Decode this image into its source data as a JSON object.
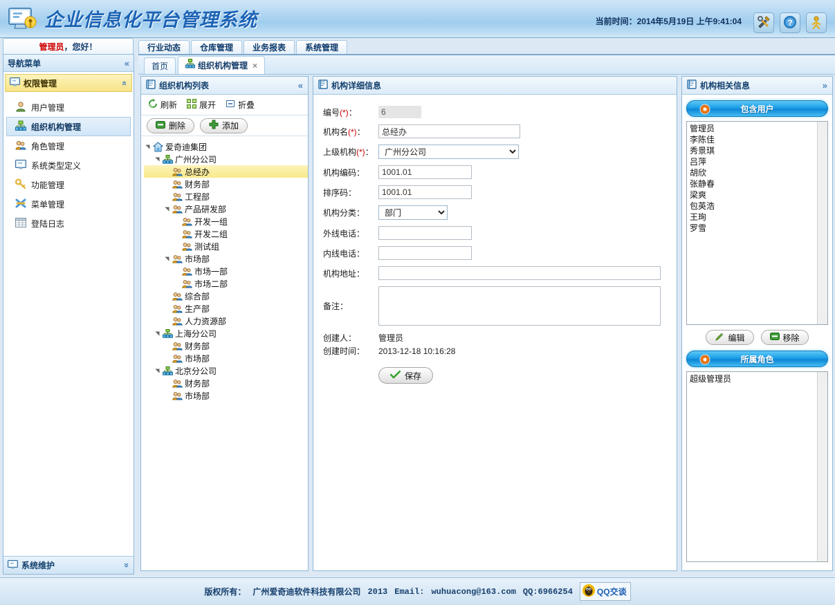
{
  "header": {
    "app_title": "企业信息化平台管理系统",
    "clock_label": "当前时间：",
    "clock_value": "2014年5月19日  上午9:41:04",
    "buttons": [
      {
        "name": "tools-icon",
        "title": "工具"
      },
      {
        "name": "help-icon",
        "title": "帮助"
      },
      {
        "name": "user-icon",
        "title": "用户"
      }
    ],
    "accent_color": "#1c63b5"
  },
  "greeting": {
    "user": "管理员",
    "rest": "，您好！"
  },
  "topmenu": {
    "items": [
      "行业动态",
      "仓库管理",
      "业务报表",
      "系统管理"
    ]
  },
  "tabs": [
    {
      "label": "首页",
      "active": false,
      "closable": false
    },
    {
      "label": "组织机构管理",
      "active": true,
      "closable": true,
      "close": "×"
    }
  ],
  "nav": {
    "title": "导航菜单",
    "collapse_icon": "«",
    "group": {
      "label": "权限管理",
      "icon": "monitor-icon",
      "chevron": "«"
    },
    "items": [
      {
        "label": "用户管理",
        "icon": "user-icon",
        "selected": false
      },
      {
        "label": "组织机构管理",
        "icon": "org-icon",
        "selected": true
      },
      {
        "label": "角色管理",
        "icon": "roles-icon",
        "selected": false
      },
      {
        "label": "系统类型定义",
        "icon": "monitor-icon",
        "selected": false
      },
      {
        "label": "功能管理",
        "icon": "key-icon",
        "selected": false
      },
      {
        "label": "菜单管理",
        "icon": "menu-icon",
        "selected": false
      },
      {
        "label": "登陆日志",
        "icon": "grid-icon",
        "selected": false
      }
    ],
    "bottom_group": {
      "label": "系统维护",
      "icon": "monitor-icon",
      "chevron": "»"
    }
  },
  "tree_panel": {
    "title": "组织机构列表",
    "collapse_icon": "«",
    "toolbar": [
      {
        "label": "刷新",
        "icon": "refresh-icon"
      },
      {
        "label": "展开",
        "icon": "expand-icon"
      },
      {
        "label": "折叠",
        "icon": "collapse-icon"
      }
    ],
    "buttons": [
      {
        "label": "删除",
        "icon": "minus-icon"
      },
      {
        "label": "添加",
        "icon": "plus-icon"
      }
    ],
    "nodes": [
      {
        "label": "爱奇迪集团",
        "depth": 0,
        "icon": "home-icon",
        "arrow": "▴",
        "selected": false
      },
      {
        "label": "广州分公司",
        "depth": 1,
        "icon": "branch-icon",
        "arrow": "▴",
        "selected": false
      },
      {
        "label": "总经办",
        "depth": 2,
        "icon": "dept-icon",
        "arrow": "",
        "selected": true
      },
      {
        "label": "财务部",
        "depth": 2,
        "icon": "dept-icon",
        "arrow": "",
        "selected": false
      },
      {
        "label": "工程部",
        "depth": 2,
        "icon": "dept-icon",
        "arrow": "",
        "selected": false
      },
      {
        "label": "产品研发部",
        "depth": 2,
        "icon": "dept-icon",
        "arrow": "▴",
        "selected": false
      },
      {
        "label": "开发一组",
        "depth": 3,
        "icon": "dept-icon",
        "arrow": "",
        "selected": false
      },
      {
        "label": "开发二组",
        "depth": 3,
        "icon": "dept-icon",
        "arrow": "",
        "selected": false
      },
      {
        "label": "测试组",
        "depth": 3,
        "icon": "dept-icon",
        "arrow": "",
        "selected": false
      },
      {
        "label": "市场部",
        "depth": 2,
        "icon": "dept-icon",
        "arrow": "▴",
        "selected": false
      },
      {
        "label": "市场一部",
        "depth": 3,
        "icon": "dept-icon",
        "arrow": "",
        "selected": false
      },
      {
        "label": "市场二部",
        "depth": 3,
        "icon": "dept-icon",
        "arrow": "",
        "selected": false
      },
      {
        "label": "综合部",
        "depth": 2,
        "icon": "dept-icon",
        "arrow": "",
        "selected": false
      },
      {
        "label": "生产部",
        "depth": 2,
        "icon": "dept-icon",
        "arrow": "",
        "selected": false
      },
      {
        "label": "人力资源部",
        "depth": 2,
        "icon": "dept-icon",
        "arrow": "",
        "selected": false
      },
      {
        "label": "上海分公司",
        "depth": 1,
        "icon": "branch-icon",
        "arrow": "▴",
        "selected": false
      },
      {
        "label": "财务部",
        "depth": 2,
        "icon": "dept-icon",
        "arrow": "",
        "selected": false
      },
      {
        "label": "市场部",
        "depth": 2,
        "icon": "dept-icon",
        "arrow": "",
        "selected": false
      },
      {
        "label": "北京分公司",
        "depth": 1,
        "icon": "branch-icon",
        "arrow": "▴",
        "selected": false
      },
      {
        "label": "财务部",
        "depth": 2,
        "icon": "dept-icon",
        "arrow": "",
        "selected": false
      },
      {
        "label": "市场部",
        "depth": 2,
        "icon": "dept-icon",
        "arrow": "",
        "selected": false
      }
    ]
  },
  "detail_panel": {
    "title": "机构详细信息",
    "fields": {
      "id_label": "编号(*)：",
      "id_value": "6",
      "name_label": "机构名(*)：",
      "name_value": "总经办",
      "parent_label": "上级机构(*)：",
      "parent_value": "广州分公司",
      "code_label": "机构编码：",
      "code_value": "1001.01",
      "sort_label": "排序码：",
      "sort_value": "1001.01",
      "type_label": "机构分类：",
      "type_value": "部门",
      "outer_phone_label": "外线电话：",
      "outer_phone_value": "",
      "inner_phone_label": "内线电话：",
      "inner_phone_value": "",
      "address_label": "机构地址：",
      "address_value": "",
      "remark_label": "备注：",
      "remark_value": "",
      "creator_label": "创建人：",
      "creator_value": "管理员",
      "created_label": "创建时间：",
      "created_value": "2013-12-18  10:16:28"
    },
    "save_button": "保存"
  },
  "info_panel": {
    "title": "机构相关信息",
    "expand_icon": "»",
    "users_section": {
      "title": "包含用户",
      "bullet": "●"
    },
    "users": [
      "管理员",
      "李陈佳",
      "秀景琪",
      "吕萍",
      "胡欣",
      "张静春",
      "梁爽",
      "包英浩",
      "王珣",
      "罗雪"
    ],
    "user_buttons": [
      {
        "label": "编辑",
        "icon": "pencil-icon"
      },
      {
        "label": "移除",
        "icon": "minus-icon"
      }
    ],
    "roles_section": {
      "title": "所属角色",
      "bullet": "●"
    },
    "roles": [
      "超级管理员"
    ]
  },
  "footer": {
    "copyright_label": "版权所有：",
    "company": "广州爱奇迪软件科技有限公司",
    "year": "2013",
    "email_label": "Email:",
    "email": "wuhuacong@163.com",
    "qq_label": "QQ:6966254",
    "qq_button": "QQ交谈"
  }
}
